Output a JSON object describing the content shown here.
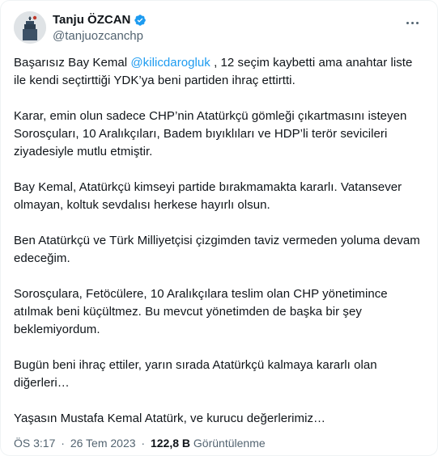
{
  "author": {
    "display_name": "Tanju ÖZCAN",
    "handle": "@tanjuozcanchp",
    "verified_color": "#1d9bf0"
  },
  "icons": {
    "more": "more-horizontal-icon",
    "verified": "verified-badge-icon"
  },
  "tweet": {
    "p1_before": "Başarısız Bay Kemal ",
    "p1_mention": "@kilicdarogluk",
    "p1_after": " , 12 seçim kaybetti ama anahtar liste ile kendi seçtirttiği YDK’ya beni partiden ihraç ettirtti.",
    "p2": "Karar, emin olun sadece CHP’nin Atatürkçü gömleği çıkartmasını isteyen Sorosçuları, 10 Aralıkçıları, Badem bıyıklıları ve HDP’li terör sevicileri ziyadesiyle mutlu etmiştir.",
    "p3": "Bay Kemal, Atatürkçü kimseyi partide bırakmamakta kararlı. Vatansever olmayan, koltuk sevdalısı herkese hayırlı olsun.",
    "p4": "Ben Atatürkçü ve Türk Milliyetçisi çizgimden taviz vermeden yoluma devam edeceğim.",
    "p5": "Sorosçulara, Fetöcülere, 10 Aralıkçılara teslim olan CHP yönetimince atılmak beni küçültmez. Bu mevcut yönetimden de başka bir şey beklemiyordum.",
    "p6": "Bugün beni ihraç ettiler, yarın sırada Atatürkçü kalmaya kararlı olan diğerleri…",
    "p7": "Yaşasın Mustafa Kemal Atatürk, ve kurucu değerlerimiz…"
  },
  "meta": {
    "time": "ÖS 3:17",
    "separator": "·",
    "date": "26 Tem 2023",
    "views_count": "122,8 B",
    "views_label": "Görüntülenme"
  }
}
